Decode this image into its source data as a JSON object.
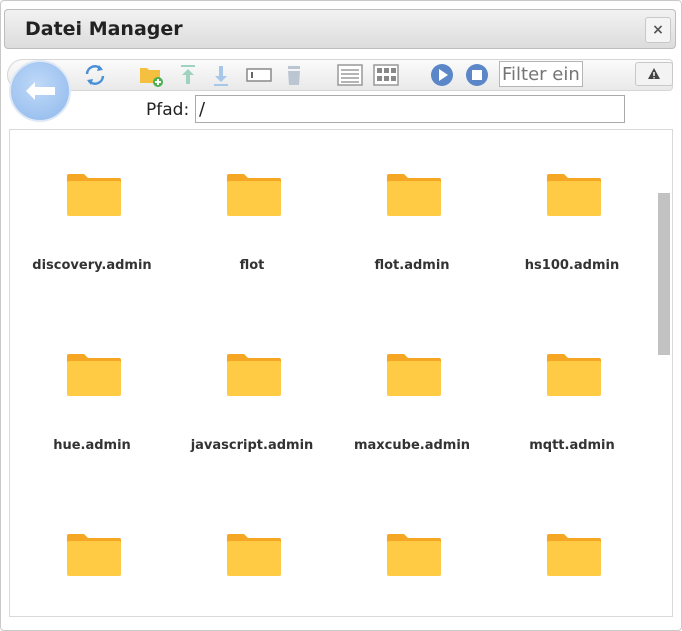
{
  "window": {
    "title": "Datei Manager",
    "close_label": "×"
  },
  "toolbar": {
    "filter_placeholder": "Filter ein",
    "icons": [
      "back-arrow-icon",
      "refresh-icon",
      "new-folder-icon",
      "upload-icon",
      "download-icon",
      "rename-icon",
      "delete-icon",
      "list-view-icon",
      "tile-view-icon",
      "play-icon",
      "stop-icon",
      "warning-icon"
    ]
  },
  "path": {
    "label": "Pfad:",
    "value": "/"
  },
  "colors": {
    "folder_body": "#ffca44",
    "folder_tab": "#f5a623",
    "accent": "#8fb8ec"
  },
  "items": [
    {
      "name": "discovery.admin"
    },
    {
      "name": "flot"
    },
    {
      "name": "flot.admin"
    },
    {
      "name": "hs100.admin"
    },
    {
      "name": "hue.admin"
    },
    {
      "name": "javascript.admin"
    },
    {
      "name": "maxcube.admin"
    },
    {
      "name": "mqtt.admin"
    },
    {
      "name": ""
    },
    {
      "name": ""
    },
    {
      "name": ""
    },
    {
      "name": ""
    }
  ]
}
